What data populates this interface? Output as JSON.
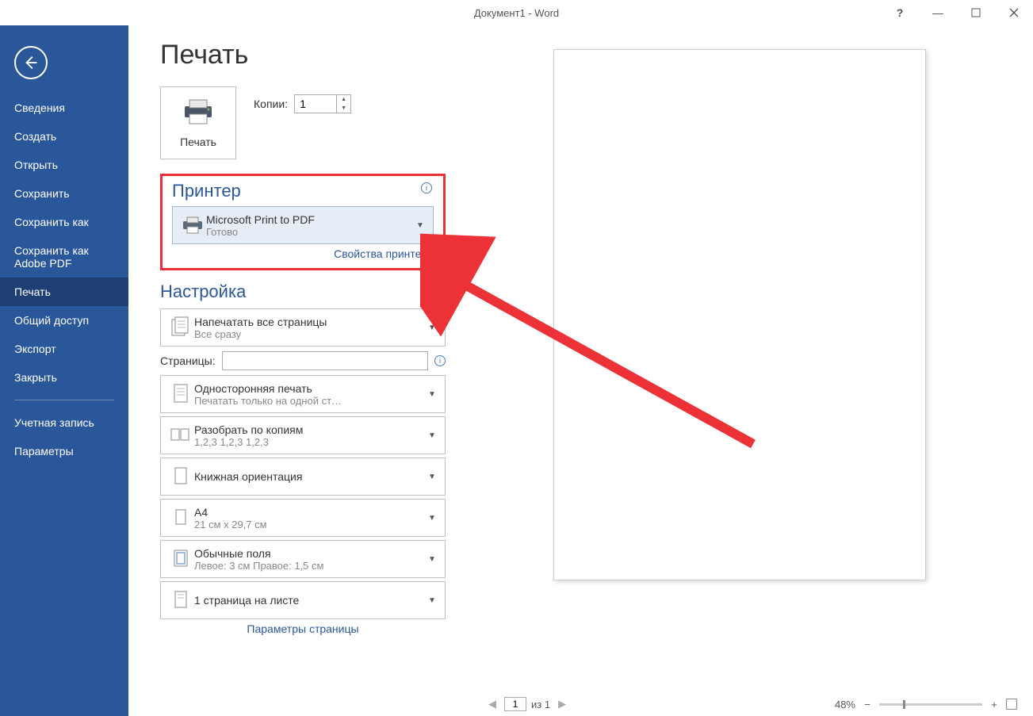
{
  "titlebar": {
    "title": "Документ1 - Word",
    "help": "?",
    "minimize": "—"
  },
  "sidebar": {
    "items": [
      "Сведения",
      "Создать",
      "Открыть",
      "Сохранить",
      "Сохранить как",
      "Сохранить как Adobe PDF",
      "Печать",
      "Общий доступ",
      "Экспорт",
      "Закрыть"
    ],
    "bottom": [
      "Учетная запись",
      "Параметры"
    ],
    "active_index": 6
  },
  "page": {
    "title": "Печать"
  },
  "print": {
    "button_label": "Печать",
    "copies_label": "Копии:",
    "copies_value": "1"
  },
  "printer": {
    "section_title": "Принтер",
    "name": "Microsoft Print to PDF",
    "status": "Готово",
    "properties_link": "Свойства принтера"
  },
  "settings": {
    "section_title": "Настройка",
    "print_all": {
      "line1": "Напечатать все страницы",
      "line2": "Все сразу"
    },
    "pages_label": "Страницы:",
    "pages_value": "",
    "one_sided": {
      "line1": "Односторонняя печать",
      "line2": "Печатать только на одной ст…"
    },
    "collate": {
      "line1": "Разобрать по копиям",
      "line2": "1,2,3    1,2,3    1,2,3"
    },
    "orientation": {
      "line1": "Книжная ориентация",
      "line2": ""
    },
    "paper": {
      "line1": "A4",
      "line2": "21 см x 29,7 см"
    },
    "margins": {
      "line1": "Обычные поля",
      "line2": "Левое:  3 см    Правое:  1,5 см"
    },
    "per_sheet": {
      "line1": "1 страница на листе",
      "line2": ""
    },
    "page_setup_link": "Параметры страницы"
  },
  "footer": {
    "page_value": "1",
    "of_text": "из 1",
    "zoom_text": "48%"
  }
}
